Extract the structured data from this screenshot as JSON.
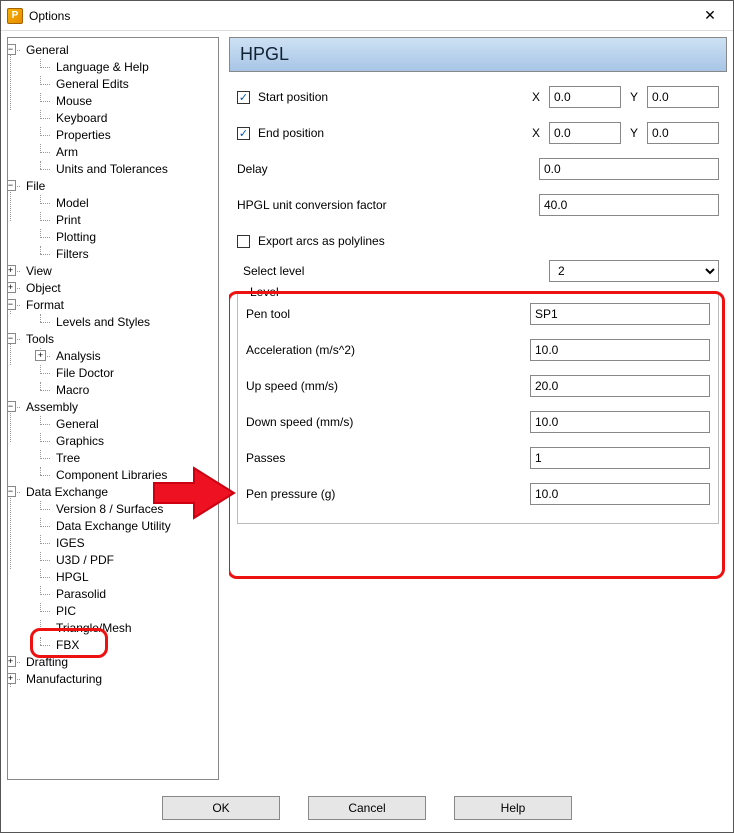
{
  "window": {
    "title": "Options"
  },
  "tree": {
    "general": {
      "label": "General",
      "children": {
        "lang": "Language & Help",
        "edits": "General Edits",
        "mouse": "Mouse",
        "keyboard": "Keyboard",
        "props": "Properties",
        "arm": "Arm",
        "units": "Units and Tolerances"
      }
    },
    "file": {
      "label": "File",
      "children": {
        "model": "Model",
        "print": "Print",
        "plotting": "Plotting",
        "filters": "Filters"
      }
    },
    "view": {
      "label": "View"
    },
    "object": {
      "label": "Object"
    },
    "format": {
      "label": "Format",
      "children": {
        "levels": "Levels and Styles"
      }
    },
    "tools": {
      "label": "Tools",
      "children": {
        "analysis": "Analysis",
        "filedoctor": "File Doctor",
        "macro": "Macro"
      }
    },
    "assembly": {
      "label": "Assembly",
      "children": {
        "general": "General",
        "graphics": "Graphics",
        "tree": "Tree",
        "complib": "Component Libraries"
      }
    },
    "datax": {
      "label": "Data Exchange",
      "children": {
        "v8": "Version 8 / Surfaces",
        "dxu": "Data Exchange Utility",
        "iges": "IGES",
        "u3d": "U3D / PDF",
        "hpgl": "HPGL",
        "parasolid": "Parasolid",
        "pic": "PIC",
        "trimesh": "Triangle/Mesh",
        "fbx": "FBX"
      }
    },
    "drafting": {
      "label": "Drafting"
    },
    "manufacturing": {
      "label": "Manufacturing"
    }
  },
  "panel": {
    "title": "HPGL",
    "start_position": {
      "label": "Start position",
      "checked": true,
      "x": "0.0",
      "y": "0.0"
    },
    "end_position": {
      "label": "End position",
      "checked": true,
      "x": "0.0",
      "y": "0.0"
    },
    "xy": {
      "xlabel": "X",
      "ylabel": "Y"
    },
    "delay": {
      "label": "Delay",
      "value": "0.0"
    },
    "conv": {
      "label": "HPGL unit conversion factor",
      "value": "40.0"
    },
    "export_arcs": {
      "label": "Export arcs as polylines",
      "checked": false
    },
    "select_level": {
      "label": "Select level",
      "value": "2"
    },
    "level_group": {
      "legend": "Level",
      "pen_tool": {
        "label": "Pen tool",
        "value": "SP1"
      },
      "accel": {
        "label": "Acceleration (m/s^2)",
        "value": "10.0"
      },
      "up": {
        "label": "Up speed (mm/s)",
        "value": "20.0"
      },
      "down": {
        "label": "Down speed (mm/s)",
        "value": "10.0"
      },
      "passes": {
        "label": "Passes",
        "value": "1"
      },
      "pressure": {
        "label": "Pen pressure (g)",
        "value": "10.0"
      }
    }
  },
  "buttons": {
    "ok": "OK",
    "cancel": "Cancel",
    "help": "Help"
  },
  "glyphs": {
    "check": "✓",
    "minus": "−",
    "plus": "+"
  }
}
